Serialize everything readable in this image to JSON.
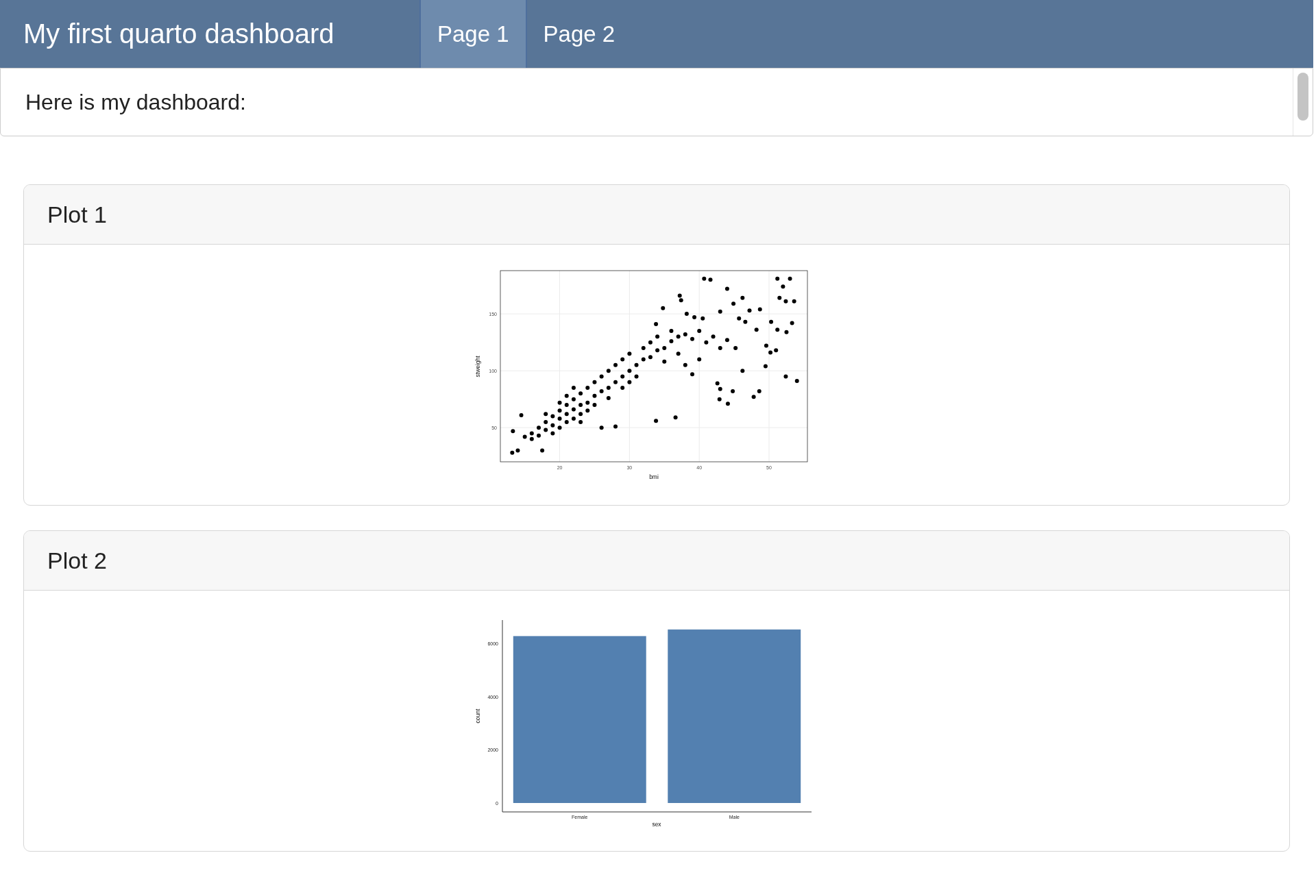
{
  "navbar": {
    "title": "My first quarto dashboard",
    "tabs": [
      {
        "label": "Page 1",
        "selected": true
      },
      {
        "label": "Page 2",
        "selected": false
      }
    ]
  },
  "intro": {
    "text": "Here is my dashboard:"
  },
  "cards": [
    {
      "title": "Plot 1",
      "chart_data": {
        "type": "scatter",
        "xlabel": "bmi",
        "ylabel": "stweight",
        "xlim": [
          11.5,
          55.5
        ],
        "ylim": [
          20,
          188
        ],
        "xticks": [
          20,
          30,
          40,
          50
        ],
        "yticks": [
          50,
          100,
          150
        ],
        "grid": true,
        "series": [
          {
            "color": "#000000",
            "x": [
              40.7,
              41.6,
              51.2,
              53,
              52,
              44,
              37.2,
              37.4,
              46.2,
              51.5,
              52.4,
              53.6,
              44.9,
              34.8,
              43,
              47.2,
              48.7,
              38.2,
              39.3,
              40.5,
              45.7,
              50.3,
              53.3,
              33.8,
              46.6,
              51.2,
              52.5,
              48.2,
              45.2,
              49.6,
              50.2,
              51,
              49.5,
              46.2,
              52.4,
              54,
              42.6,
              43,
              44.8,
              48.6,
              47.8,
              42.9,
              44.1,
              36.6,
              33.8,
              26,
              28,
              13.2,
              14,
              17.5,
              13.3,
              14.5,
              16,
              17,
              18,
              18,
              19,
              19,
              20,
              20,
              20,
              21,
              21,
              21,
              22,
              22,
              22,
              23,
              23,
              23,
              24,
              24,
              24,
              25,
              25,
              25,
              26,
              26,
              27,
              27,
              27,
              28,
              28,
              29,
              29,
              29,
              30,
              30,
              30,
              31,
              31,
              32,
              32,
              33,
              33,
              34,
              34,
              35,
              35,
              36,
              36,
              37,
              37,
              38,
              38,
              39,
              39,
              40,
              40,
              41,
              42,
              43,
              44,
              16,
              17,
              15,
              18,
              19,
              22,
              20,
              21,
              23
            ],
            "values": [
              181,
              180,
              181,
              181,
              174,
              172,
              166,
              162,
              164,
              164,
              161,
              161,
              159,
              155,
              152,
              153,
              154,
              150,
              147,
              146,
              146,
              143,
              142,
              141,
              143,
              136,
              134,
              136,
              120,
              122,
              116,
              118,
              104,
              100,
              95,
              91,
              89,
              84,
              82,
              82,
              77,
              75,
              71,
              59,
              56,
              50,
              51,
              28,
              30,
              30,
              47,
              61,
              45,
              50,
              55,
              48,
              60,
              52,
              58,
              65,
              50,
              62,
              70,
              55,
              66,
              75,
              58,
              70,
              80,
              62,
              72,
              85,
              65,
              78,
              90,
              70,
              82,
              95,
              85,
              100,
              76,
              90,
              105,
              95,
              110,
              85,
              100,
              115,
              90,
              105,
              95,
              110,
              120,
              112,
              125,
              118,
              130,
              120,
              108,
              126,
              135,
              130,
              115,
              132,
              105,
              128,
              97,
              135,
              110,
              125,
              130,
              120,
              127,
              40,
              43,
              42,
              62,
              45,
              85,
              72,
              78,
              55
            ]
          }
        ]
      }
    },
    {
      "title": "Plot 2",
      "chart_data": {
        "type": "bar",
        "xlabel": "sex",
        "ylabel": "count",
        "categories": [
          "Female",
          "Male"
        ],
        "ylim": [
          -336,
          6905
        ],
        "yticks": [
          0,
          2000,
          4000,
          6000
        ],
        "series": [
          {
            "color": "#5380b0",
            "values": [
              6300,
              6550
            ]
          }
        ]
      }
    }
  ]
}
